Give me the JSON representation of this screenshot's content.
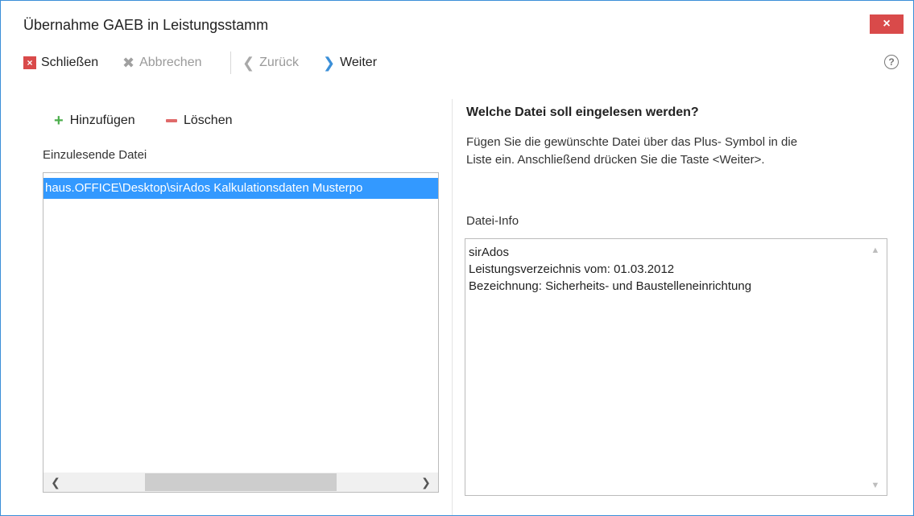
{
  "window": {
    "title": "Übernahme GAEB in Leistungsstamm",
    "close_label": "×"
  },
  "toolbar": {
    "close_label": "Schließen",
    "cancel_label": "Abbrechen",
    "back_label": "Zurück",
    "next_label": "Weiter",
    "help_label": "?"
  },
  "left": {
    "add_label": "Hinzufügen",
    "delete_label": "Löschen",
    "list_label": "Einzulesende Datei",
    "files": [
      "haus.OFFICE\\Desktop\\sirAdos Kalkulationsdaten Musterpo"
    ]
  },
  "right": {
    "heading": "Welche Datei soll eingelesen werden?",
    "instruction_line1": "Fügen Sie die gewünschte Datei über das Plus- Symbol in die",
    "instruction_line2": "Liste ein. Anschließend drücken Sie die Taste <Weiter>.",
    "info_label": "Datei-Info",
    "info_lines": [
      "sirAdos",
      "Leistungsverzeichnis vom: 01.03.2012",
      "Bezeichnung: Sicherheits- und Baustelleneinrichtung"
    ]
  },
  "colors": {
    "accent": "#3b8fd8",
    "selection": "#3399ff",
    "close": "#d94a4a",
    "add": "#4cae4c",
    "delete": "#e06a6a"
  }
}
